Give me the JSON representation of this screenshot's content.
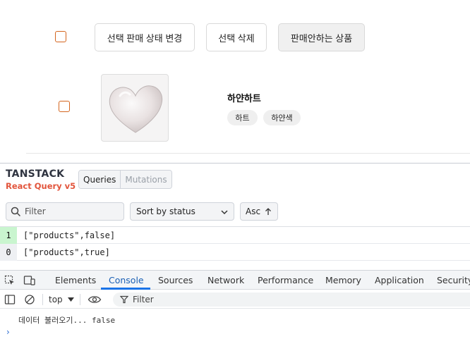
{
  "toolbar": {
    "change_status_label": "선택 판매 상태 변경",
    "delete_label": "선택 삭제",
    "unsold_label": "판매안하는 상품"
  },
  "product": {
    "name": "하얀하트",
    "tags": [
      "하트",
      "하얀색"
    ]
  },
  "react_query_devtools": {
    "logo_line1": "TANSTACK",
    "logo_line2": "React Query v5",
    "tabs": [
      "Queries",
      "Mutations"
    ],
    "filter_placeholder": "Filter",
    "sort_select": "Sort by status",
    "order_button": "Asc",
    "queries": [
      {
        "count": "1",
        "key": "[\"products\",false]",
        "status_color": "#c9f5cf"
      },
      {
        "count": "0",
        "key": "[\"products\",true]",
        "status_color": "#eef0f3"
      }
    ]
  },
  "browser_devtools": {
    "tabs": [
      "Elements",
      "Console",
      "Sources",
      "Network",
      "Performance",
      "Memory",
      "Application",
      "Security"
    ],
    "active_tab": "Console",
    "context_select": "top",
    "filter_label": "Filter",
    "console_lines": [
      "데이터 불러오기... false"
    ]
  },
  "colors": {
    "checkbox_border": "#d4651e",
    "rq_logo_accent": "#e2553c",
    "devtools_active": "#1a73e8"
  }
}
